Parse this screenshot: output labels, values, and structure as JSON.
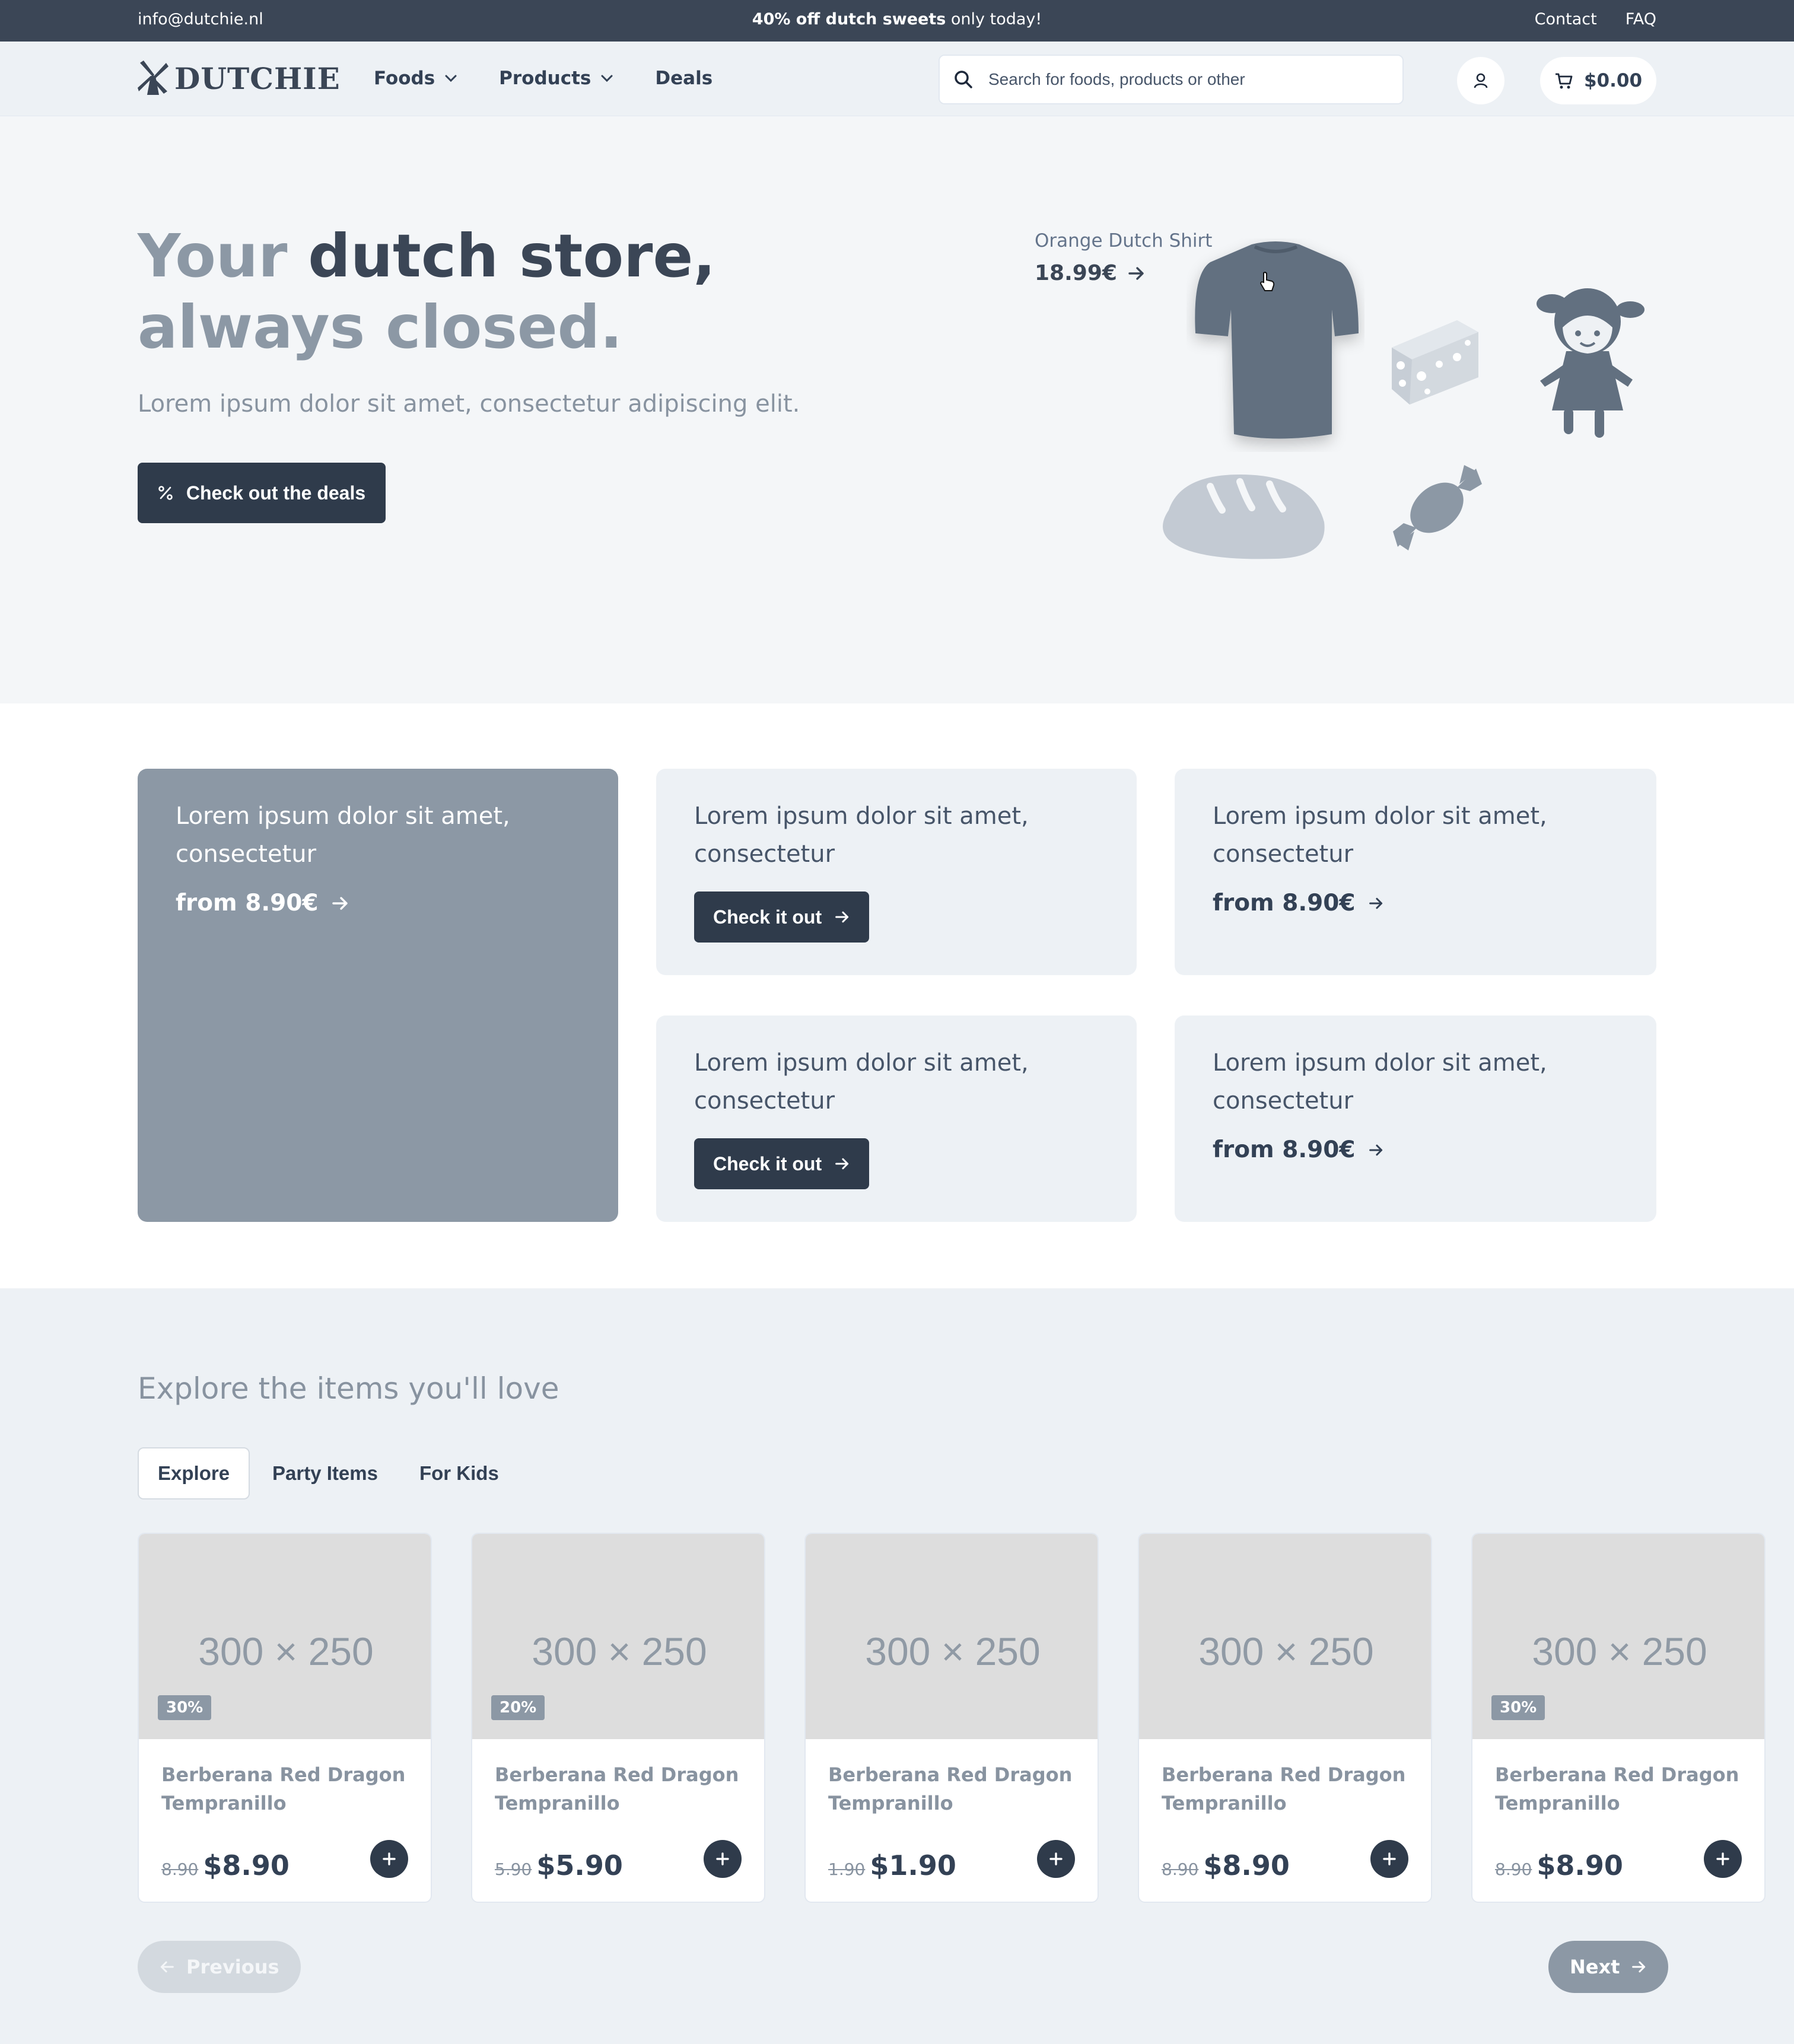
{
  "topbar": {
    "email": "info@dutchie.nl",
    "promo_bold": "40% off dutch sweets",
    "promo_rest": " only today!",
    "contact": "Contact",
    "faq": "FAQ"
  },
  "header": {
    "brand": "DUTCHIE",
    "nav": {
      "foods": "Foods",
      "products": "Products",
      "deals": "Deals"
    },
    "search_placeholder": "Search for foods, products or other",
    "cart_total": "$0.00"
  },
  "hero": {
    "title_part1": "Your ",
    "title_part2": "dutch store,",
    "title_part3": "always closed.",
    "subtitle": "Lorem ipsum dolor sit amet, consectetur adipiscing elit.",
    "cta": "Check out the deals",
    "featured_name": "Orange Dutch Shirt",
    "featured_price": "18.99€"
  },
  "promos": [
    {
      "text": "Lorem ipsum dolor sit amet, consectetur",
      "price": "from 8.90€"
    },
    {
      "text": "Lorem ipsum dolor sit amet, consectetur",
      "button": "Check it out"
    },
    {
      "text": "Lorem ipsum dolor sit amet, consectetur",
      "price": "from 8.90€"
    },
    {
      "text": "Lorem ipsum dolor sit amet, consectetur",
      "button": "Check it out"
    },
    {
      "text": "Lorem ipsum dolor sit amet, consectetur",
      "price": "from 8.90€"
    }
  ],
  "explore": {
    "heading": "Explore the items you'll love",
    "tabs": [
      "Explore",
      "Party Items",
      "For Kids"
    ],
    "products": [
      {
        "placeholder": "300 × 250",
        "badge": "30%",
        "name": "Berberana Red Dragon Tempranillo",
        "old_price": "8.90",
        "price": "$8.90"
      },
      {
        "placeholder": "300 × 250",
        "badge": "20%",
        "name": "Berberana Red Dragon Tempranillo",
        "old_price": "5.90",
        "price": "$5.90"
      },
      {
        "placeholder": "300 × 250",
        "badge": "",
        "name": "Berberana Red Dragon Tempranillo",
        "old_price": "1.90",
        "price": "$1.90"
      },
      {
        "placeholder": "300 × 250",
        "badge": "",
        "name": "Berberana Red Dragon Tempranillo",
        "old_price": "8.90",
        "price": "$8.90"
      },
      {
        "placeholder": "300 × 250",
        "badge": "30%",
        "name": "Berberana Red Dragon Tempranillo",
        "old_price": "8.90",
        "price": "$8.90"
      }
    ],
    "previous": "Previous",
    "next": "Next"
  },
  "colors": {
    "dark": "#2f3b4b",
    "topbar": "#3b4656",
    "muted": "#8c98a5",
    "light_bg": "#edf1f5"
  },
  "icons": [
    "windmill-logo-icon",
    "chevron-down-icon",
    "search-icon",
    "user-icon",
    "cart-icon",
    "percent-icon",
    "arrow-right-icon",
    "arrow-left-icon",
    "plus-icon",
    "cursor-pointer-icon"
  ]
}
